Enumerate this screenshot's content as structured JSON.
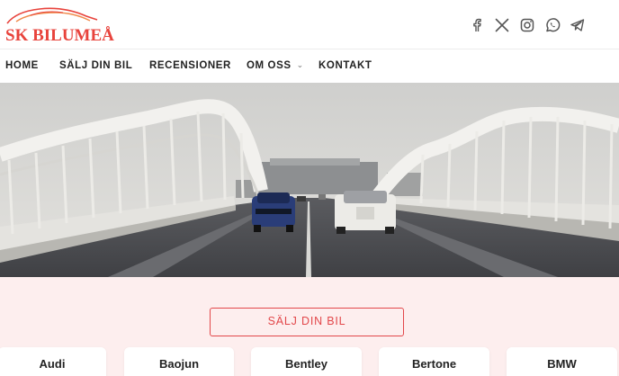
{
  "logo": {
    "text": "SK BILUMEÅ"
  },
  "social": [
    "facebook-icon",
    "x-icon",
    "instagram-icon",
    "whatsapp-icon",
    "telegram-icon"
  ],
  "nav": {
    "items": [
      {
        "label": "HOME"
      },
      {
        "label": "SÄLJ DIN BIL"
      },
      {
        "label": "RECENSIONER"
      },
      {
        "label": "OM OSS",
        "has_dropdown": true
      },
      {
        "label": "KONTAKT"
      }
    ]
  },
  "hero": {
    "image": "two-cars-on-curved-white-arch-bridge-photo"
  },
  "cta": {
    "label": "SÄLJ DIN BIL"
  },
  "brands": [
    "Audi",
    "Baojun",
    "Bentley",
    "Bertone",
    "BMW"
  ],
  "colors": {
    "accent": "#e2474a",
    "section_bg": "#fdeeee",
    "text": "#222222"
  }
}
